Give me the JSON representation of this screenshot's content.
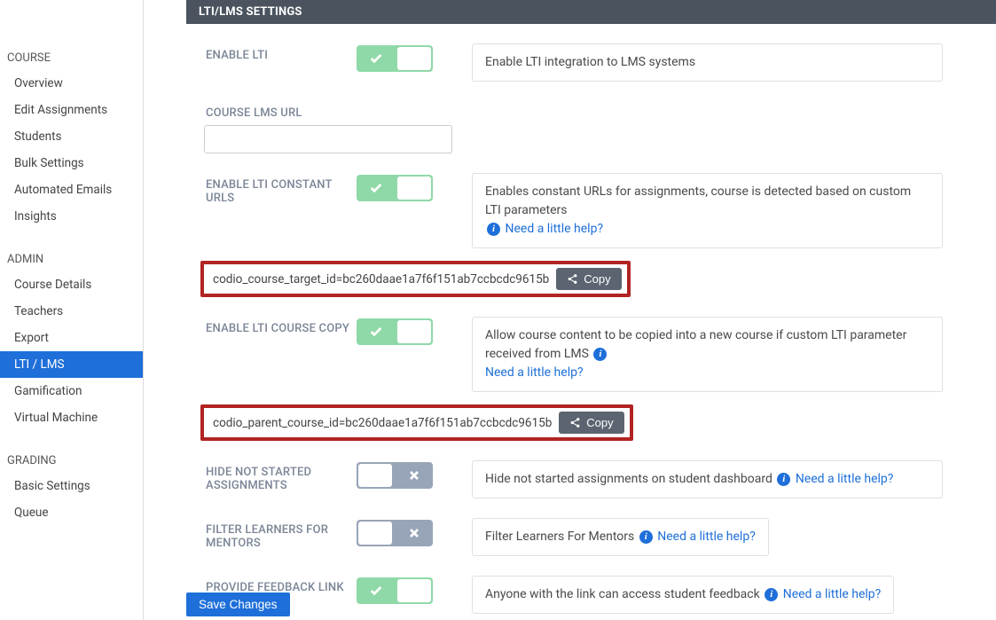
{
  "sidebar": {
    "sections": [
      {
        "title": "COURSE",
        "items": [
          "Overview",
          "Edit Assignments",
          "Students",
          "Bulk Settings",
          "Automated Emails",
          "Insights"
        ]
      },
      {
        "title": "ADMIN",
        "items": [
          "Course Details",
          "Teachers",
          "Export",
          "LTI / LMS",
          "Gamification",
          "Virtual Machine"
        ]
      },
      {
        "title": "GRADING",
        "items": [
          "Basic Settings",
          "Queue"
        ]
      }
    ],
    "active": "LTI / LMS"
  },
  "panel": {
    "header": "LTI/LMS SETTINGS",
    "save_button": "Save Changes"
  },
  "settings": {
    "enable_lti": {
      "label": "ENABLE LTI",
      "desc": "Enable LTI integration to LMS systems",
      "on": true
    },
    "course_lms_url": {
      "label": "COURSE LMS URL",
      "value": ""
    },
    "enable_constant_urls": {
      "label": "ENABLE LTI CONSTANT URLS",
      "desc": "Enables constant URLs for assignments, course is detected based on custom LTI parameters",
      "help": "Need a little help?",
      "on": true
    },
    "course_target_id": {
      "text": "codio_course_target_id=bc260daae1a7f6f151ab7ccbcdc9615b",
      "copy": "Copy"
    },
    "enable_course_copy": {
      "label": "ENABLE LTI COURSE COPY",
      "desc": "Allow course content to be copied into a new course if custom LTI parameter received from LMS",
      "help": "Need a little help?",
      "on": true
    },
    "parent_course_id": {
      "text": "codio_parent_course_id=bc260daae1a7f6f151ab7ccbcdc9615b",
      "copy": "Copy"
    },
    "hide_not_started": {
      "label": "HIDE NOT STARTED ASSIGNMENTS",
      "desc": "Hide not started assignments on student dashboard",
      "help": "Need a little help?",
      "on": false
    },
    "filter_learners": {
      "label": "FILTER LEARNERS FOR MENTORS",
      "desc": "Filter Learners For Mentors",
      "help": "Need a little help?",
      "on": false
    },
    "provide_feedback": {
      "label": "PROVIDE FEEDBACK LINK",
      "desc": "Anyone with the link can access student feedback",
      "help": "Need a little help?",
      "on": true
    }
  }
}
